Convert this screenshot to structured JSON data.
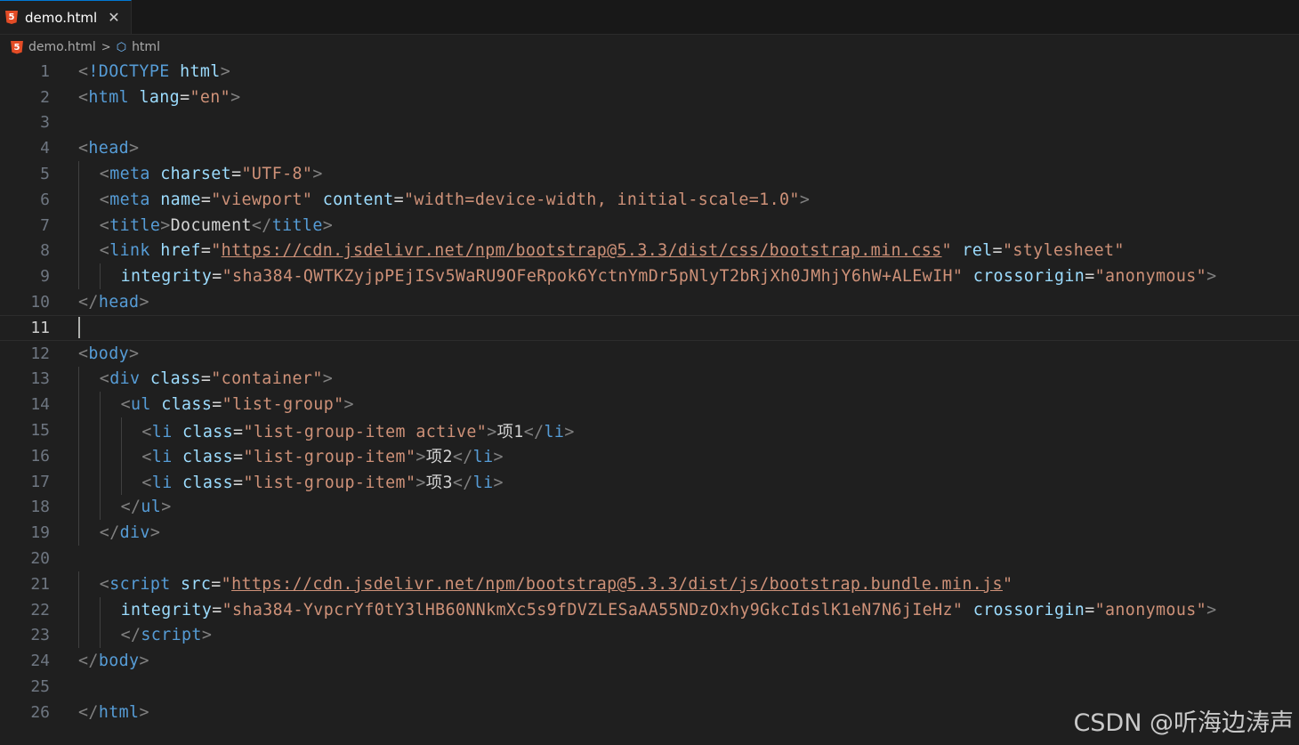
{
  "tab": {
    "filename": "demo.html",
    "close_glyph": "✕",
    "icon": "html5-icon"
  },
  "breadcrumb": {
    "file": "demo.html",
    "separator": ">",
    "symbol": "html",
    "symbol_icon": "cube-icon"
  },
  "editor": {
    "current_line": 11,
    "lines": [
      {
        "n": "1",
        "indent": 0,
        "tokens": [
          [
            "p",
            "<"
          ],
          [
            "t",
            "!DOCTYPE"
          ],
          [
            "tx",
            " "
          ],
          [
            "a",
            "html"
          ],
          [
            "p",
            ">"
          ]
        ]
      },
      {
        "n": "2",
        "indent": 0,
        "tokens": [
          [
            "p",
            "<"
          ],
          [
            "t",
            "html"
          ],
          [
            "tx",
            " "
          ],
          [
            "a",
            "lang"
          ],
          [
            "eq",
            "="
          ],
          [
            "s",
            "\"en\""
          ],
          [
            "p",
            ">"
          ]
        ]
      },
      {
        "n": "3",
        "indent": 0,
        "tokens": []
      },
      {
        "n": "4",
        "indent": 0,
        "tokens": [
          [
            "p",
            "<"
          ],
          [
            "t",
            "head"
          ],
          [
            "p",
            ">"
          ]
        ]
      },
      {
        "n": "5",
        "indent": 1,
        "tokens": [
          [
            "p",
            "<"
          ],
          [
            "t",
            "meta"
          ],
          [
            "tx",
            " "
          ],
          [
            "a",
            "charset"
          ],
          [
            "eq",
            "="
          ],
          [
            "s",
            "\"UTF-8\""
          ],
          [
            "p",
            ">"
          ]
        ]
      },
      {
        "n": "6",
        "indent": 1,
        "tokens": [
          [
            "p",
            "<"
          ],
          [
            "t",
            "meta"
          ],
          [
            "tx",
            " "
          ],
          [
            "a",
            "name"
          ],
          [
            "eq",
            "="
          ],
          [
            "s",
            "\"viewport\""
          ],
          [
            "tx",
            " "
          ],
          [
            "a",
            "content"
          ],
          [
            "eq",
            "="
          ],
          [
            "s",
            "\"width=device-width, initial-scale=1.0\""
          ],
          [
            "p",
            ">"
          ]
        ]
      },
      {
        "n": "7",
        "indent": 1,
        "tokens": [
          [
            "p",
            "<"
          ],
          [
            "t",
            "title"
          ],
          [
            "p",
            ">"
          ],
          [
            "tx",
            "Document"
          ],
          [
            "p",
            "</"
          ],
          [
            "t",
            "title"
          ],
          [
            "p",
            ">"
          ]
        ]
      },
      {
        "n": "8",
        "indent": 1,
        "tokens": [
          [
            "p",
            "<"
          ],
          [
            "t",
            "link"
          ],
          [
            "tx",
            " "
          ],
          [
            "a",
            "href"
          ],
          [
            "eq",
            "="
          ],
          [
            "s",
            "\""
          ],
          [
            "u",
            "https://cdn.jsdelivr.net/npm/bootstrap@5.3.3/dist/css/bootstrap.min.css"
          ],
          [
            "s",
            "\""
          ],
          [
            "tx",
            " "
          ],
          [
            "a",
            "rel"
          ],
          [
            "eq",
            "="
          ],
          [
            "s",
            "\"stylesheet\""
          ]
        ]
      },
      {
        "n": "9",
        "indent": 2,
        "tokens": [
          [
            "a",
            "integrity"
          ],
          [
            "eq",
            "="
          ],
          [
            "s",
            "\"sha384-QWTKZyjpPEjISv5WaRU9OFeRpok6YctnYmDr5pNlyT2bRjXh0JMhjY6hW+ALEwIH\""
          ],
          [
            "tx",
            " "
          ],
          [
            "a",
            "crossorigin"
          ],
          [
            "eq",
            "="
          ],
          [
            "s",
            "\"anonymous\""
          ],
          [
            "p",
            ">"
          ]
        ]
      },
      {
        "n": "10",
        "indent": 0,
        "tokens": [
          [
            "p",
            "</"
          ],
          [
            "t",
            "head"
          ],
          [
            "p",
            ">"
          ]
        ]
      },
      {
        "n": "11",
        "indent": 0,
        "tokens": [],
        "cursor": true
      },
      {
        "n": "12",
        "indent": 0,
        "tokens": [
          [
            "p",
            "<"
          ],
          [
            "t",
            "body"
          ],
          [
            "p",
            ">"
          ]
        ]
      },
      {
        "n": "13",
        "indent": 1,
        "tokens": [
          [
            "p",
            "<"
          ],
          [
            "t",
            "div"
          ],
          [
            "tx",
            " "
          ],
          [
            "a",
            "class"
          ],
          [
            "eq",
            "="
          ],
          [
            "s",
            "\"container\""
          ],
          [
            "p",
            ">"
          ]
        ]
      },
      {
        "n": "14",
        "indent": 2,
        "tokens": [
          [
            "p",
            "<"
          ],
          [
            "t",
            "ul"
          ],
          [
            "tx",
            " "
          ],
          [
            "a",
            "class"
          ],
          [
            "eq",
            "="
          ],
          [
            "s",
            "\"list-group\""
          ],
          [
            "p",
            ">"
          ]
        ]
      },
      {
        "n": "15",
        "indent": 3,
        "tokens": [
          [
            "p",
            "<"
          ],
          [
            "t",
            "li"
          ],
          [
            "tx",
            " "
          ],
          [
            "a",
            "class"
          ],
          [
            "eq",
            "="
          ],
          [
            "s",
            "\"list-group-item active\""
          ],
          [
            "p",
            ">"
          ],
          [
            "tx",
            "项1"
          ],
          [
            "p",
            "</"
          ],
          [
            "t",
            "li"
          ],
          [
            "p",
            ">"
          ]
        ]
      },
      {
        "n": "16",
        "indent": 3,
        "tokens": [
          [
            "p",
            "<"
          ],
          [
            "t",
            "li"
          ],
          [
            "tx",
            " "
          ],
          [
            "a",
            "class"
          ],
          [
            "eq",
            "="
          ],
          [
            "s",
            "\"list-group-item\""
          ],
          [
            "p",
            ">"
          ],
          [
            "tx",
            "项2"
          ],
          [
            "p",
            "</"
          ],
          [
            "t",
            "li"
          ],
          [
            "p",
            ">"
          ]
        ]
      },
      {
        "n": "17",
        "indent": 3,
        "tokens": [
          [
            "p",
            "<"
          ],
          [
            "t",
            "li"
          ],
          [
            "tx",
            " "
          ],
          [
            "a",
            "class"
          ],
          [
            "eq",
            "="
          ],
          [
            "s",
            "\"list-group-item\""
          ],
          [
            "p",
            ">"
          ],
          [
            "tx",
            "项3"
          ],
          [
            "p",
            "</"
          ],
          [
            "t",
            "li"
          ],
          [
            "p",
            ">"
          ]
        ]
      },
      {
        "n": "18",
        "indent": 2,
        "tokens": [
          [
            "p",
            "</"
          ],
          [
            "t",
            "ul"
          ],
          [
            "p",
            ">"
          ]
        ]
      },
      {
        "n": "19",
        "indent": 1,
        "tokens": [
          [
            "p",
            "</"
          ],
          [
            "t",
            "div"
          ],
          [
            "p",
            ">"
          ]
        ]
      },
      {
        "n": "20",
        "indent": 0,
        "tokens": []
      },
      {
        "n": "21",
        "indent": 1,
        "tokens": [
          [
            "p",
            "<"
          ],
          [
            "t",
            "script"
          ],
          [
            "tx",
            " "
          ],
          [
            "a",
            "src"
          ],
          [
            "eq",
            "="
          ],
          [
            "s",
            "\""
          ],
          [
            "u",
            "https://cdn.jsdelivr.net/npm/bootstrap@5.3.3/dist/js/bootstrap.bundle.min.js"
          ],
          [
            "s",
            "\""
          ]
        ]
      },
      {
        "n": "22",
        "indent": 2,
        "tokens": [
          [
            "a",
            "integrity"
          ],
          [
            "eq",
            "="
          ],
          [
            "s",
            "\"sha384-YvpcrYf0tY3lHB60NNkmXc5s9fDVZLESaAA55NDzOxhy9GkcIdslK1eN7N6jIeHz\""
          ],
          [
            "tx",
            " "
          ],
          [
            "a",
            "crossorigin"
          ],
          [
            "eq",
            "="
          ],
          [
            "s",
            "\"anonymous\""
          ],
          [
            "p",
            ">"
          ]
        ]
      },
      {
        "n": "23",
        "indent": 2,
        "tokens": [
          [
            "p",
            "</"
          ],
          [
            "t",
            "script"
          ],
          [
            "p",
            ">"
          ]
        ]
      },
      {
        "n": "24",
        "indent": 0,
        "tokens": [
          [
            "p",
            "</"
          ],
          [
            "t",
            "body"
          ],
          [
            "p",
            ">"
          ]
        ]
      },
      {
        "n": "25",
        "indent": 0,
        "tokens": []
      },
      {
        "n": "26",
        "indent": 0,
        "tokens": [
          [
            "p",
            "</"
          ],
          [
            "t",
            "html"
          ],
          [
            "p",
            ">"
          ]
        ]
      }
    ]
  },
  "watermark": "CSDN @听海边涛声"
}
